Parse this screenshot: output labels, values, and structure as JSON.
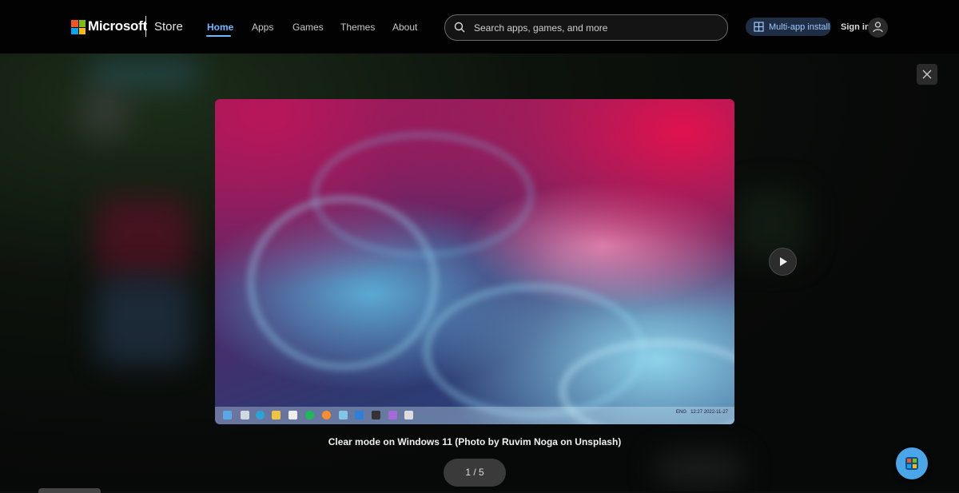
{
  "header": {
    "brand": "Microsoft",
    "product": "Store",
    "nav": [
      {
        "label": "Home",
        "active": true
      },
      {
        "label": "Apps",
        "active": false
      },
      {
        "label": "Games",
        "active": false
      },
      {
        "label": "Themes",
        "active": false
      },
      {
        "label": "About",
        "active": false
      }
    ],
    "search_placeholder": "Search apps, games, and more",
    "multi_app_label": "Multi-app install",
    "signin_label": "Sign in",
    "logo_colors": [
      "#f35325",
      "#81bc06",
      "#05a6f0",
      "#ffba08"
    ],
    "accent": "#6fb8ff"
  },
  "viewer": {
    "caption": "Clear mode on Windows 11 (Photo by Ruvim Noga on Unsplash)",
    "counter": "1 / 5",
    "close_icon": "close-icon",
    "next_icon": "play-next-icon"
  },
  "screenshot_taskbar": {
    "tray_lang": "ENG",
    "time": "12:27",
    "date": "2022-11-27"
  }
}
